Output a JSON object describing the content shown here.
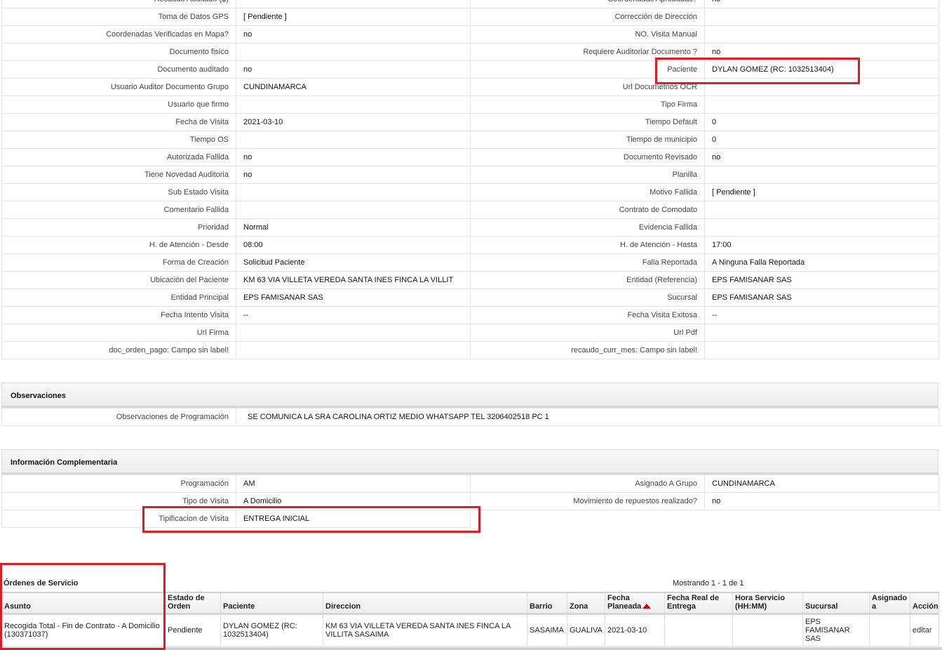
{
  "details": {
    "rows": [
      {
        "l1": "Recaudo Auditado ($)",
        "v1": "",
        "l2": "Coordenadas Aprobadas?",
        "v2": "no"
      },
      {
        "l1": "Toma de Datos GPS",
        "v1": "[ Pendiente ]",
        "l2": "Corrección de Dirección",
        "v2": ""
      },
      {
        "l1": "Coordenadas Verificadas en Mapa?",
        "v1": "no",
        "l2": "NO. Visita Manual",
        "v2": ""
      },
      {
        "l1": "Documento fisico",
        "v1": "",
        "l2": "Requiere Auditoriar Documento ?",
        "v2": "no"
      },
      {
        "l1": "Documento auditado",
        "v1": "no",
        "l2": "Paciente",
        "v2": "DYLAN GOMEZ (RC: 1032513404)"
      },
      {
        "l1": "Usuario Auditor Documento Grupo",
        "v1": "CUNDINAMARCA",
        "l2": "Url Documetnos OCR",
        "v2": ""
      },
      {
        "l1": "Usuario que firmo",
        "v1": "",
        "l2": "Tipo Firma",
        "v2": ""
      },
      {
        "l1": "Fecha de Visita",
        "v1": "2021-03-10",
        "l2": "Tiempo Default",
        "v2": "0"
      },
      {
        "l1": "Tiempo OS",
        "v1": "",
        "l2": "Tiempo de municipio",
        "v2": "0"
      },
      {
        "l1": "Autorizada Fallida",
        "v1": "no",
        "l2": "Documento Revisado",
        "v2": "no"
      },
      {
        "l1": "Tiene Novedad Auditoria",
        "v1": "no",
        "l2": "Planilla",
        "v2": ""
      },
      {
        "l1": "Sub Estado Visita",
        "v1": "",
        "l2": "Motivo Fallida",
        "v2": "[ Pendiente ]"
      },
      {
        "l1": "Comentario Fallida",
        "v1": "",
        "l2": "Contrato de Comodato",
        "v2": ""
      },
      {
        "l1": "Prioridad",
        "v1": "Normal",
        "l2": "Evidencia Fallida",
        "v2": ""
      },
      {
        "l1": "H. de Atención - Desde",
        "v1": "08:00",
        "l2": "H. de Atención - Hasta",
        "v2": "17:00"
      },
      {
        "l1": "Forma de Creación",
        "v1": "Solicitud Paciente",
        "l2": "Falla Reportada",
        "v2": "A Ninguna Falla Reportada"
      },
      {
        "l1": "Ubicación del Paciente",
        "v1": "KM 63 VIA VILLETA VEREDA SANTA INES FINCA LA VILLIT",
        "l2": "Entidad (Referencia)",
        "v2": "EPS FAMISANAR SAS"
      },
      {
        "l1": "Entidad Principal",
        "v1": "EPS FAMISANAR SAS",
        "l2": "Sucursal",
        "v2": "EPS FAMISANAR SAS"
      },
      {
        "l1": "Fecha Intento Visita",
        "v1": "--",
        "l2": "Fecha Visita Exitosa",
        "v2": "--"
      },
      {
        "l1": "Url Firma",
        "v1": "",
        "l2": "Url Pdf",
        "v2": ""
      },
      {
        "l1": "doc_orden_pago: Campo sin label!",
        "v1": "",
        "l2": "recaudo_curr_mes: Campo sin label!",
        "v2": ""
      }
    ]
  },
  "observaciones": {
    "title": "Observaciones",
    "label": "Observaciones de Programación",
    "value": "SE COMUNICA LA SRA CAROLINA ORTIZ MEDIO WHATSAPP TEL 3206402518 PC 1"
  },
  "complementaria": {
    "title": "Información Complementaria",
    "programacion_label": "Programación",
    "programacion_value": "AM",
    "asignado_label": "Asignado A Grupo",
    "asignado_value": "CUNDINAMARCA",
    "tipo_label": "Tipo de Visita",
    "tipo_value": "A Domicilio",
    "movimiento_label": "Movimiento de repuestos realizado?",
    "movimiento_value": "no",
    "tipificacion_label": "Tipificacion de Visita",
    "tipificacion_value": "ENTREGA INICIAL"
  },
  "ordenes": {
    "title": "Órdenes de Servicio",
    "count": "Mostrando 1 - 1 de 1",
    "headers": {
      "asunto": "Asunto",
      "estado": "Estado de Orden",
      "paciente": "Paciente",
      "direccion": "Direccion",
      "barrio": "Barrio",
      "zona": "Zona",
      "fecha_planeada": "Fecha Planeada",
      "fecha_real": "Fecha Real de Entrega",
      "hora": "Hora Servicio (HH:MM)",
      "sucursal": "Sucursal",
      "asignado": "Asignado a",
      "accion": "Acción"
    },
    "row": {
      "asunto": "Recogida Total - Fin de Contrato - A Domicilio (130371037)",
      "estado": "Pendiente",
      "paciente": "DYLAN GOMEZ (RC: 1032513404)",
      "direccion": "KM 63 VIA VILLETA VEREDA SANTA INES FINCA LA VILLITA SASAIMA",
      "barrio": "SASAIMA",
      "zona": "GUALIVA",
      "fecha_planeada": "2021-03-10",
      "fecha_real": "",
      "hora": "",
      "sucursal": "EPS FAMISANAR SAS",
      "asignado": "",
      "accion": "editar"
    }
  },
  "colors": {
    "highlight": "#e11b22",
    "border": "#e3e3e3"
  },
  "icons": {
    "sort": "sort-ascending-icon"
  }
}
